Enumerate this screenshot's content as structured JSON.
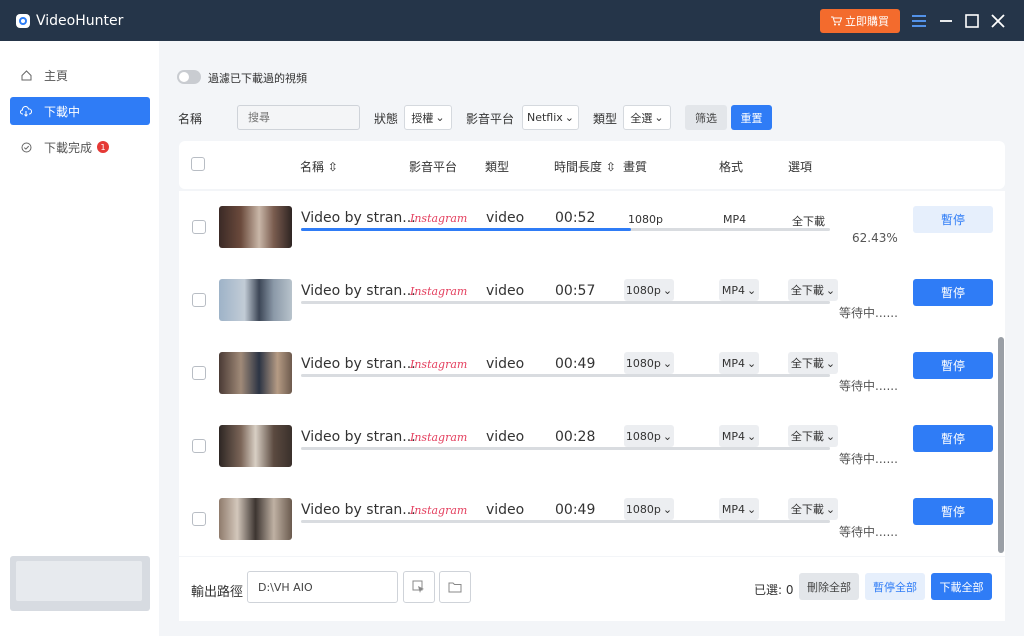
{
  "app": {
    "title": "VideoHunter",
    "buy_label": "立即購買"
  },
  "sidebar": {
    "items": [
      {
        "label": "主頁"
      },
      {
        "label": "下載中"
      },
      {
        "label": "下載完成",
        "badge": "1"
      }
    ]
  },
  "filters": {
    "toggle_label": "過濾已下載過的視頻",
    "name_label": "名稱",
    "search_placeholder": "搜尋",
    "status_label": "狀態",
    "status_value": "授權",
    "platform_label": "影音平台",
    "platform_value": "Netflix",
    "type_label": "類型",
    "type_value": "全選",
    "filter_button": "筛选",
    "reset_button": "重置"
  },
  "table": {
    "headers": [
      "名稱",
      "影音平台",
      "類型",
      "時間長度",
      "畫質",
      "格式",
      "選項"
    ],
    "rows": [
      {
        "title": "Video by stran...",
        "platform": "Instagram",
        "type": "video",
        "duration": "00:52",
        "quality": "1080p",
        "format": "MP4",
        "option": "全下載",
        "status": "62.43%",
        "progress": 62.43,
        "action": "暫停"
      },
      {
        "title": "Video by stran...",
        "platform": "Instagram",
        "type": "video",
        "duration": "00:57",
        "quality": "1080p",
        "format": "MP4",
        "option": "全下載",
        "status": "等待中......",
        "progress": 0,
        "action": "暫停"
      },
      {
        "title": "Video by stran...",
        "platform": "Instagram",
        "type": "video",
        "duration": "00:49",
        "quality": "1080p",
        "format": "MP4",
        "option": "全下載",
        "status": "等待中......",
        "progress": 0,
        "action": "暫停"
      },
      {
        "title": "Video by stran...",
        "platform": "Instagram",
        "type": "video",
        "duration": "00:28",
        "quality": "1080p",
        "format": "MP4",
        "option": "全下載",
        "status": "等待中......",
        "progress": 0,
        "action": "暫停"
      },
      {
        "title": "Video by stran...",
        "platform": "Instagram",
        "type": "video",
        "duration": "00:49",
        "quality": "1080p",
        "format": "MP4",
        "option": "全下載",
        "status": "等待中......",
        "progress": 0,
        "action": "暫停"
      }
    ]
  },
  "footer": {
    "output_label": "輸出路徑",
    "output_path": "D:\\VH AIO",
    "selected_text": "已選: 0",
    "delete_all": "刪除全部",
    "pause_all": "暫停全部",
    "download_all": "下載全部"
  },
  "colors": {
    "accent": "#2f7cf6",
    "titlebar": "#253549",
    "buy": "#f36b2d",
    "badge": "#e53935",
    "instagram": "#e4405f"
  }
}
